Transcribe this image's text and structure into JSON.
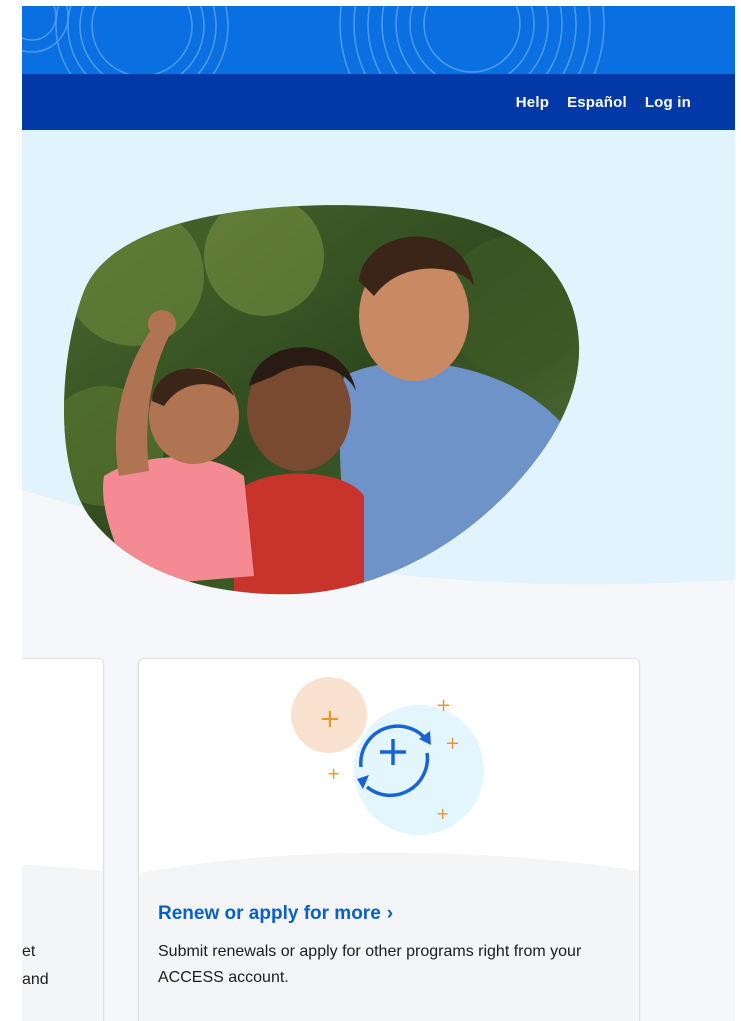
{
  "nav": {
    "links": [
      {
        "label": "Help"
      },
      {
        "label": "Español"
      },
      {
        "label": "Log in"
      }
    ]
  },
  "hero": {
    "photo_icon": "family-photo"
  },
  "cards": {
    "left": {
      "partial_lines": [
        "et",
        "and"
      ]
    },
    "main": {
      "icon": "renew-cycle-plus-icon",
      "title": "Renew or apply for more",
      "chevron": "›",
      "description": "Submit renewals or apply for other programs right from your ACCESS account."
    }
  },
  "colors": {
    "top_band": "#0a6fe0",
    "nav_bar": "#0339a6",
    "hero_bg": "#e1f4fd",
    "lower_bg": "#f6f7fa",
    "link_blue": "#0b5fc9",
    "accent_orange": "#e8962e"
  }
}
